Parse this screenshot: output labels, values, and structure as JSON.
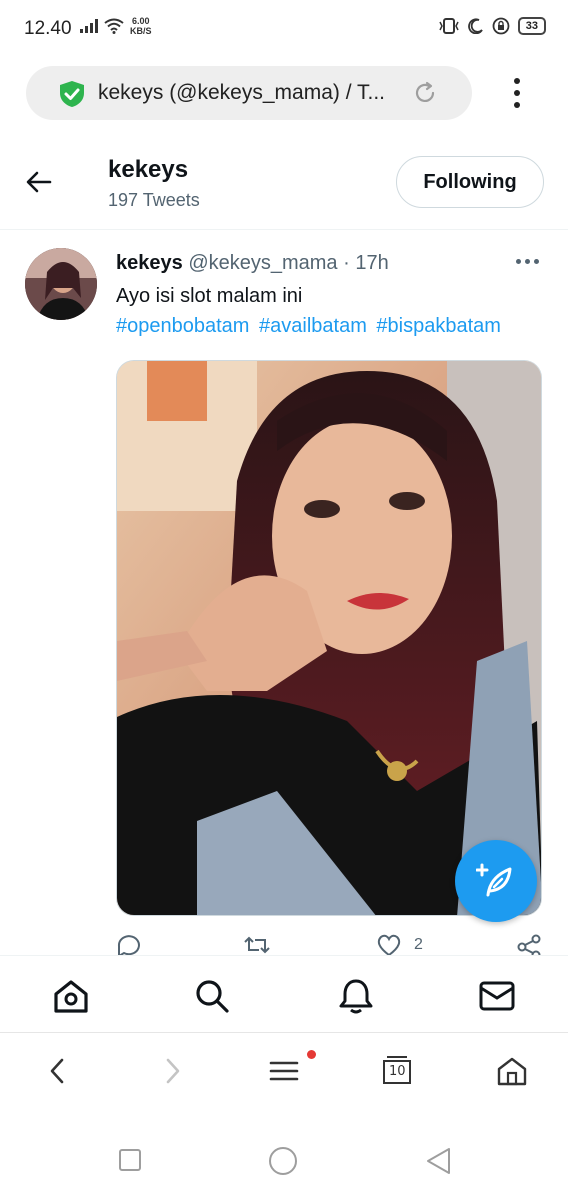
{
  "status_bar": {
    "time": "12.40",
    "speed_value": "6.00",
    "speed_unit": "KB/S",
    "battery": "33"
  },
  "browser": {
    "url_title": "kekeys (@kekeys_mama) / T..."
  },
  "profile_header": {
    "name": "kekeys",
    "tweet_count": "197 Tweets",
    "follow_button": "Following"
  },
  "tweet": {
    "display_name": "kekeys",
    "handle": "@kekeys_mama",
    "separator": "·",
    "time": "17h",
    "text": "Ayo isi slot malam ini",
    "hashtags": [
      "#openbobatam",
      "#availbatam",
      "#bispakbatam"
    ],
    "like_count": "2"
  },
  "browser_nav": {
    "tab_count": "10"
  },
  "colors": {
    "twitter_blue": "#1d9bf0",
    "secure_green": "#2eb44e",
    "text_primary": "#0f1419",
    "text_secondary": "#536471"
  }
}
